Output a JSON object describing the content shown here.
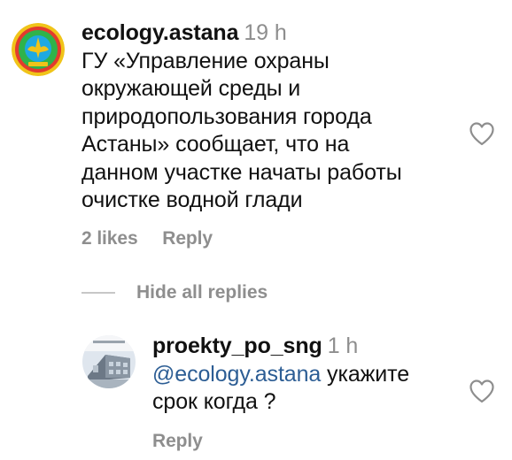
{
  "comment": {
    "username": "ecology.astana",
    "time": "19 h",
    "text_lines": [
      "ГУ «Управление охраны",
      "окружающей среды и",
      "природопользования города",
      "Астаны» сообщает, что на",
      "данном участке начаты работы",
      "очистке водной глади"
    ],
    "likes": "2 likes",
    "reply_label": "Reply"
  },
  "replies_toggle": {
    "label": "Hide all replies"
  },
  "reply": {
    "username": "proekty_po_sng",
    "time": "1 h",
    "mention": "@ecology.astana",
    "text_line1_rest": " укажите",
    "text_line2": "срок когда ?",
    "reply_label": "Reply"
  },
  "colors": {
    "muted": "#8e8e8e",
    "mention": "#2c5d94",
    "text": "#111111",
    "divider": "#c7c7c7"
  },
  "icons": {
    "like": "heart-outline-icon"
  }
}
